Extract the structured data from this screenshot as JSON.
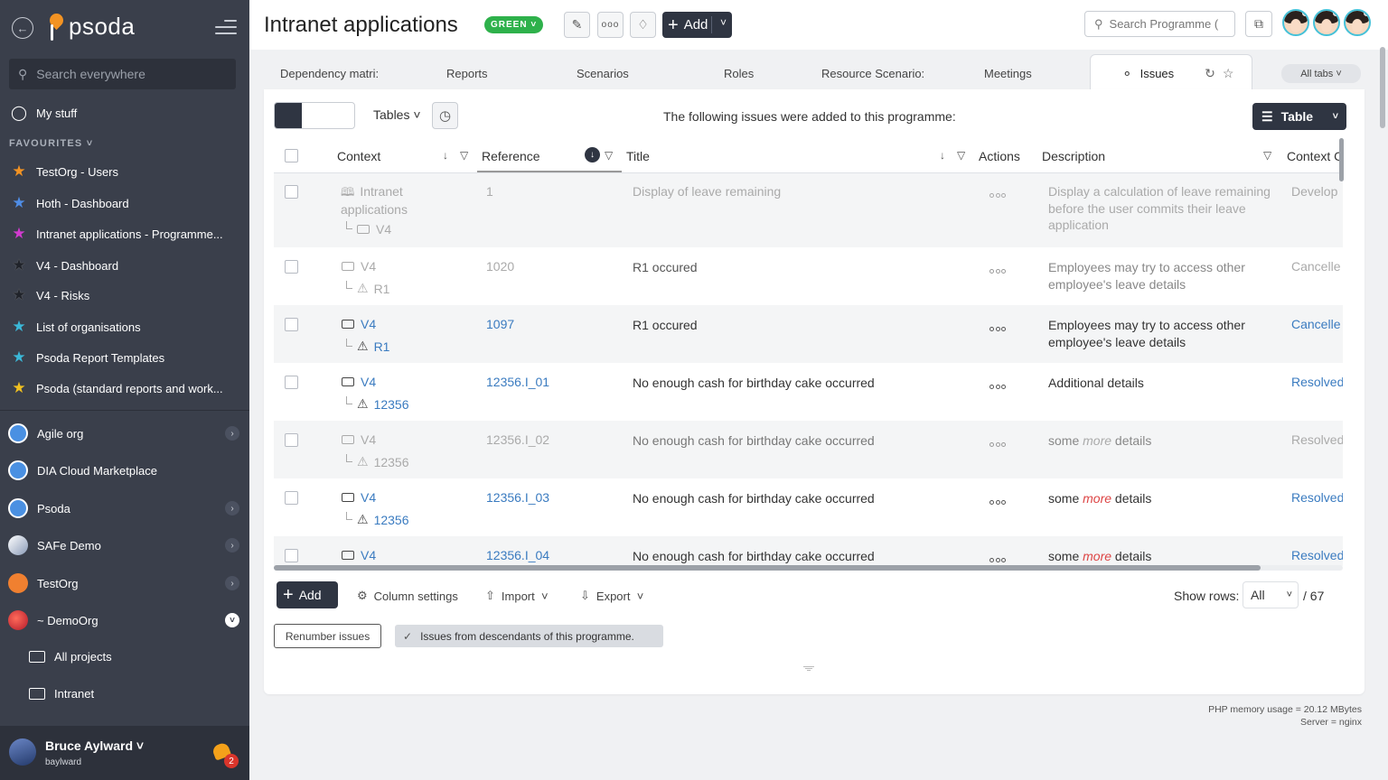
{
  "app": {
    "logo_text": "psoda"
  },
  "sidebar": {
    "search_placeholder": "Search everywhere",
    "my_stuff": "My stuff",
    "favourites_header": "FAVOURITES",
    "favourites": [
      {
        "label": "TestOrg - Users",
        "color": "#f39323"
      },
      {
        "label": "Hoth - Dashboard",
        "color": "#4f8de6"
      },
      {
        "label": "Intranet applications - Programme...",
        "color": "#d23bd0"
      },
      {
        "label": "V4 - Dashboard",
        "color": "#2b2f38"
      },
      {
        "label": "V4 - Risks",
        "color": "#2b2f38"
      },
      {
        "label": "List of organisations",
        "color": "#3bb8d8"
      },
      {
        "label": "Psoda Report Templates",
        "color": "#3bb8d8"
      },
      {
        "label": "Psoda (standard reports and work...",
        "color": "#f0c020"
      }
    ],
    "orgs": [
      {
        "label": "Agile org",
        "expand": true
      },
      {
        "label": "DIA Cloud Marketplace",
        "expand": false
      },
      {
        "label": "Psoda",
        "expand": true
      },
      {
        "label": "SAFe Demo",
        "expand": true
      },
      {
        "label": "TestOrg",
        "expand": true
      },
      {
        "label": "~ DemoOrg",
        "expand": true
      }
    ],
    "sub_items": [
      "All projects",
      "Intranet"
    ],
    "user": {
      "name": "Bruce Aylward",
      "handle": "baylward",
      "notifications": "2"
    }
  },
  "header": {
    "title": "Intranet applications",
    "status": "GREEN",
    "add_label": "Add",
    "search_placeholder": "Search Programme (",
    "status_color": "#2eb14b"
  },
  "tabs": {
    "items": [
      "Dependency matri:",
      "Reports",
      "Scenarios",
      "Roles",
      "Resource Scenario:",
      "Meetings"
    ],
    "active": "Issues",
    "all_tabs": "All tabs"
  },
  "toolbar": {
    "tables_label": "Tables",
    "intro": "The following issues were added to this programme:",
    "table_view": "Table"
  },
  "grid": {
    "columns": [
      "Context",
      "Reference",
      "Title",
      "Actions",
      "Description",
      "Context C"
    ],
    "rows": [
      {
        "ctx1": "Intranet applications",
        "ctx2": "V4",
        "ref": "1",
        "title": "Display of leave remaining",
        "desc": "Display a calculation of leave remaining before the user commits their leave application",
        "status": "Develop"
      },
      {
        "ctx1": "V4",
        "ctx2": "R1",
        "ref": "1020",
        "title": "R1 occured",
        "desc": "Employees may try to access other employee's leave details",
        "status": "Cancelle"
      },
      {
        "ctx1": "V4",
        "ctx2": "R1",
        "ref": "1097",
        "title": "R1 occured",
        "desc": "Employees may try to access other employee's leave details",
        "status": "Cancelle"
      },
      {
        "ctx1": "V4",
        "ctx2": "12356",
        "ref": "12356.I_01",
        "title": "No enough cash for birthday cake occurred",
        "desc": "Additional details",
        "status": "Resolved"
      },
      {
        "ctx1": "V4",
        "ctx2": "12356",
        "ref": "12356.I_02",
        "title": "No enough cash for birthday cake occurred",
        "desc_pre": "some",
        "desc_em": "more",
        "desc_post": "details",
        "status": "Resolved"
      },
      {
        "ctx1": "V4",
        "ctx2": "12356",
        "ref": "12356.I_03",
        "title": "No enough cash for birthday cake occurred",
        "desc_pre": "some",
        "desc_em": "more",
        "desc_post": "details",
        "status": "Resolved"
      },
      {
        "ctx1": "V4",
        "ref": "12356.I_04",
        "title": "No enough cash for birthday cake occurred",
        "desc_pre": "some",
        "desc_em": "more",
        "desc_post": "details",
        "status": "Resolved"
      }
    ]
  },
  "footer": {
    "add": "Add",
    "column_settings": "Column settings",
    "import": "Import",
    "export": "Export",
    "show_rows_label": "Show rows:",
    "show_rows_value": "All",
    "total": "/ 67",
    "renumber": "Renumber issues",
    "descendants": "Issues from descendants of this programme."
  },
  "server": {
    "memory": "PHP memory usage = 20.12 MBytes",
    "server": "Server = nginx"
  }
}
